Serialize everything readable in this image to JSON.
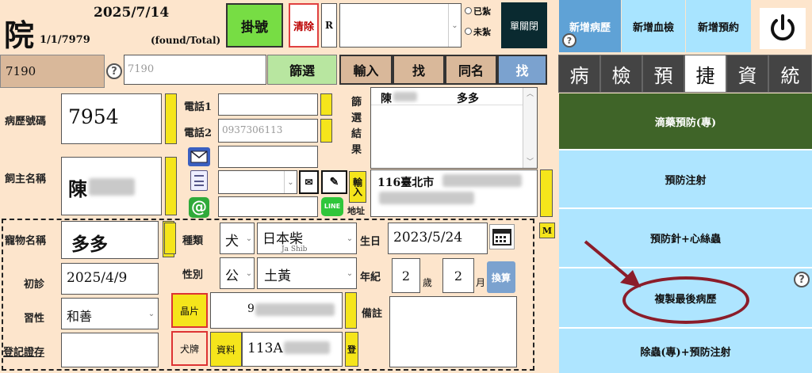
{
  "header": {
    "title": "院",
    "date": "2025/7/14",
    "record_pos": "1/1/7979",
    "found_total": "(found/Total)",
    "register_btn": "掛號",
    "clear_btn": "清除",
    "r_label": "R",
    "radio1": "已紮",
    "radio2": "未紮",
    "close_btn": "單關閉"
  },
  "topright": {
    "new_record": "新增病歷",
    "new_blood": "新增血檢",
    "new_booking": "新增預約"
  },
  "search": {
    "value": "7190",
    "mirror": "7190",
    "filter_btn": "篩選",
    "input_btn": "輸入",
    "find_btn": "找",
    "same_name_btn": "同名",
    "find2_btn": "找"
  },
  "tabs": [
    "病",
    "檢",
    "預",
    "捷",
    "資",
    "統"
  ],
  "patient": {
    "record_no_label": "病歷號碼",
    "record_no": "7954",
    "owner_label": "飼主名稱",
    "owner": "陳",
    "phone1_label": "電話1",
    "phone2_label": "電話2",
    "phone2": "0937306113",
    "pet_name_label": "寵物名稱",
    "pet_name": "多多",
    "first_visit_label": "初診",
    "first_visit": "2025/4/9",
    "habit_label": "習性",
    "habit": "和善",
    "register_cert_label": "登記證存"
  },
  "filter_result": {
    "label": "篩選結果",
    "row_owner": "陳",
    "row_pet": "多多"
  },
  "address": {
    "input_label": "輸入",
    "addr_label": "地址",
    "addr": "116臺北市",
    "m_btn": "M"
  },
  "pet": {
    "species_label": "種類",
    "species": "犬",
    "breed": "日本柴",
    "breed_sub": "Ja Shib",
    "sex_label": "性別",
    "sex": "公",
    "color": "土黃",
    "birth_label": "生日",
    "birth": "2023/5/24",
    "age_label": "年紀",
    "age_y": "2",
    "age_y_unit": "歲",
    "age_m": "2",
    "age_m_unit": "月",
    "convert_btn": "換算",
    "chip_label": "晶片",
    "chip": "9",
    "dog_tag_label": "犬牌",
    "data_label": "資料",
    "data": "113A",
    "notes_label": "備註",
    "reg_btn": "登"
  },
  "quick": [
    "滴藥預防(專)",
    "預防注射",
    "預防針+心絲蟲",
    "複製最後病歷",
    "除蟲(專)+預防注射"
  ]
}
